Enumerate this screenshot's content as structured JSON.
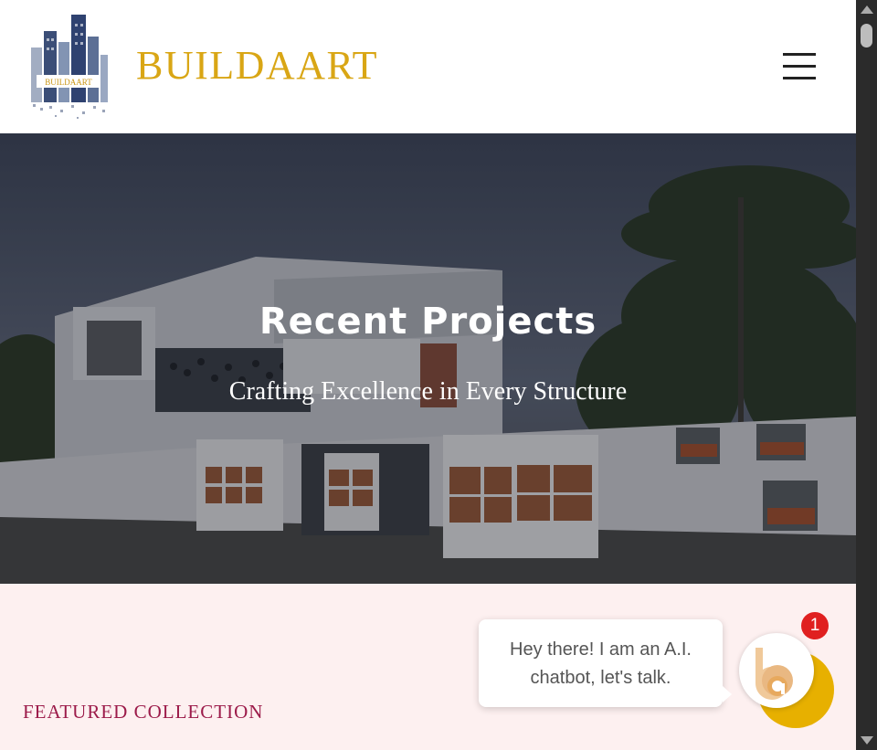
{
  "header": {
    "logo_mark_text": "BUILDAART",
    "brand": "BUILDAART",
    "brand_color": "#d9a615",
    "menu_icon": "hamburger-menu-icon"
  },
  "hero": {
    "title": "Recent Projects",
    "subtitle": "Crafting Excellence in Every Structure"
  },
  "featured": {
    "label": "FEATURED COLLECTION",
    "label_color": "#9c1b4a",
    "background": "#fdf0f0"
  },
  "chat": {
    "message_line1": "Hey there! I am an A.I.",
    "message_line2": "chatbot, let's talk.",
    "badge_count": "1",
    "accent": "#e7b000",
    "badge_color": "#e02020",
    "avatar_icon": "chatbot-logo-icon"
  }
}
